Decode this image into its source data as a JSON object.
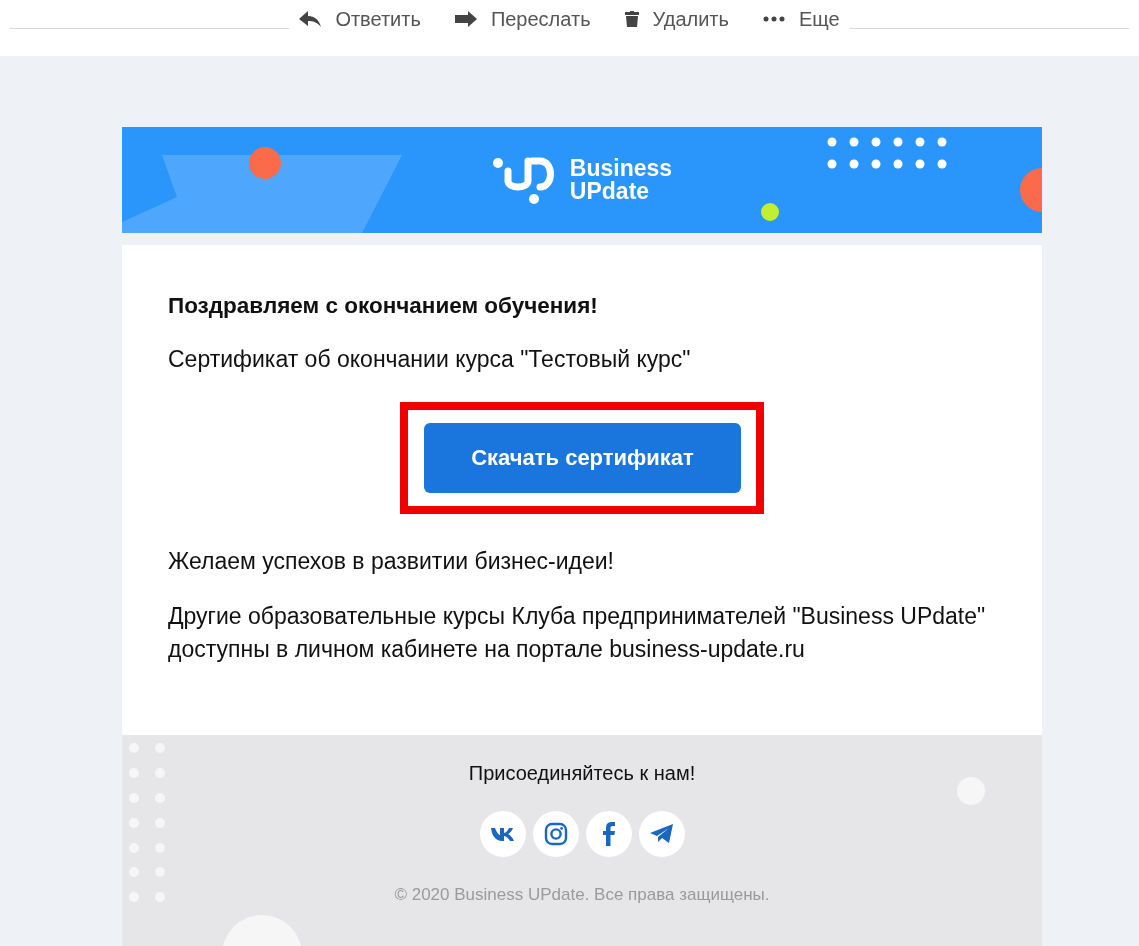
{
  "toolbar": {
    "actions": [
      {
        "kind": "reply",
        "label": "Ответить"
      },
      {
        "kind": "forward",
        "label": "Переслать"
      },
      {
        "kind": "delete",
        "label": "Удалить"
      },
      {
        "kind": "more",
        "label": "Еще"
      }
    ]
  },
  "email": {
    "header": {
      "brand_line_1": "Business",
      "brand_line_2": "UPdate"
    },
    "body": {
      "heading": "Поздравляем с окончанием обучения!",
      "subtitle": "Сертификат об окончании курса \"Тестовый курс\"",
      "button": {
        "label": "Скачать сертификат",
        "highlighted": true
      },
      "wish": "Желаем успехов в развитии бизнес-идеи!",
      "note": "Другие образовательные курсы Клуба предпринимателей \"Business UPdate\" доступны в личном кабинете на портале business-update.ru"
    },
    "footer": {
      "join": "Присоединяйтесь к нам!",
      "social": [
        {
          "kind": "vk"
        },
        {
          "kind": "instagram"
        },
        {
          "kind": "facebook"
        },
        {
          "kind": "telegram"
        }
      ],
      "copyright": "© 2020 Business UPdate. Все права защищены."
    }
  }
}
